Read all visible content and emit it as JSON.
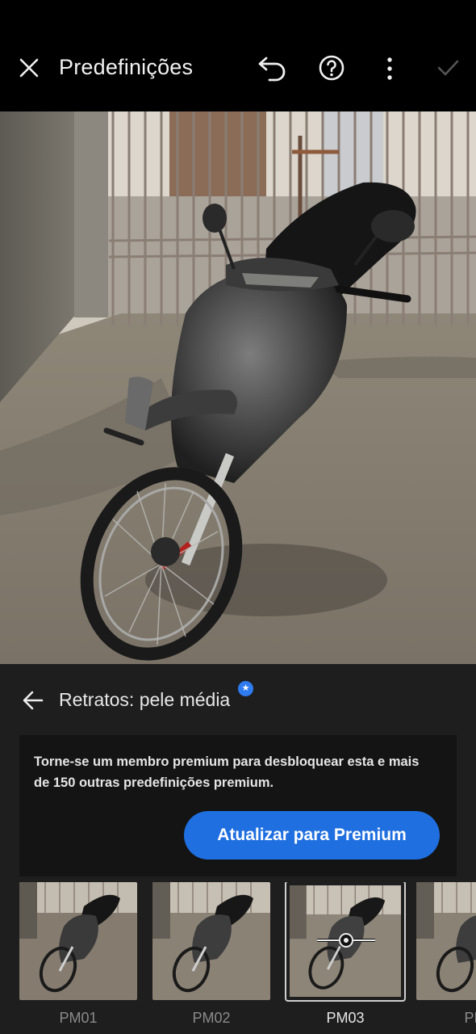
{
  "header": {
    "title": "Predefinições",
    "icons": [
      "close-icon",
      "undo-icon",
      "help-icon",
      "more-vertical-icon",
      "check-icon"
    ]
  },
  "panel": {
    "title": "Retratos: pele média",
    "promo_message": "Torne-se um membro premium para desbloquear esta e mais de 150 outras predefinições premium.",
    "upgrade_button": "Atualizar para Premium",
    "accent_color": "#1f6fe0"
  },
  "presets": [
    {
      "label": "PM01",
      "selected": false
    },
    {
      "label": "PM02",
      "selected": false
    },
    {
      "label": "PM03",
      "selected": true
    },
    {
      "label": "PM",
      "selected": false
    }
  ]
}
